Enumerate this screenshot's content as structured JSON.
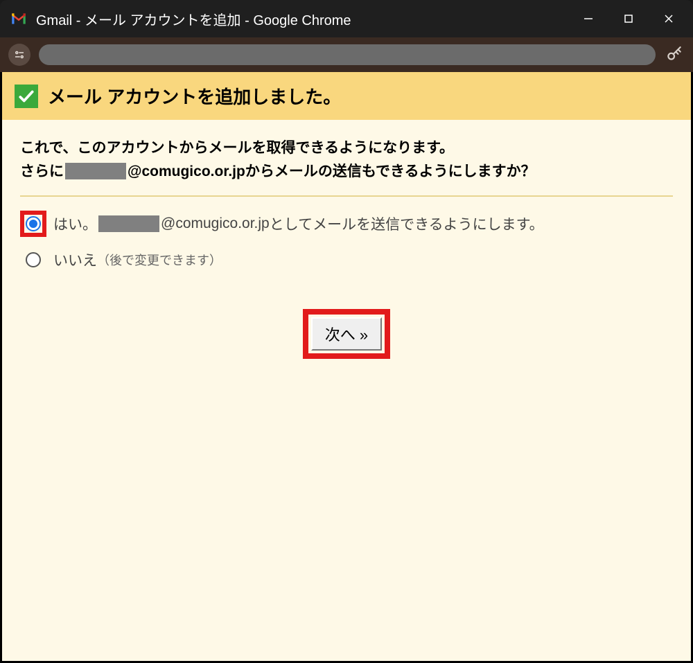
{
  "window": {
    "title": "Gmail - メール アカウントを追加 - Google Chrome"
  },
  "banner": {
    "text": "メール アカウントを追加しました。"
  },
  "intro": {
    "line1": "これで、このアカウントからメールを取得できるようになります。",
    "line2_prefix": "さらに ",
    "line2_domain": "@comugico.or.jp",
    "line2_suffix": " からメールの送信もできるようにしますか？"
  },
  "options": {
    "yes_prefix": "はい。",
    "yes_domain": "@comugico.or.jp",
    "yes_suffix": " としてメールを送信できるようにします。",
    "no_label": "いいえ",
    "no_note": "（後で変更できます）"
  },
  "buttons": {
    "next": "次へ »"
  }
}
